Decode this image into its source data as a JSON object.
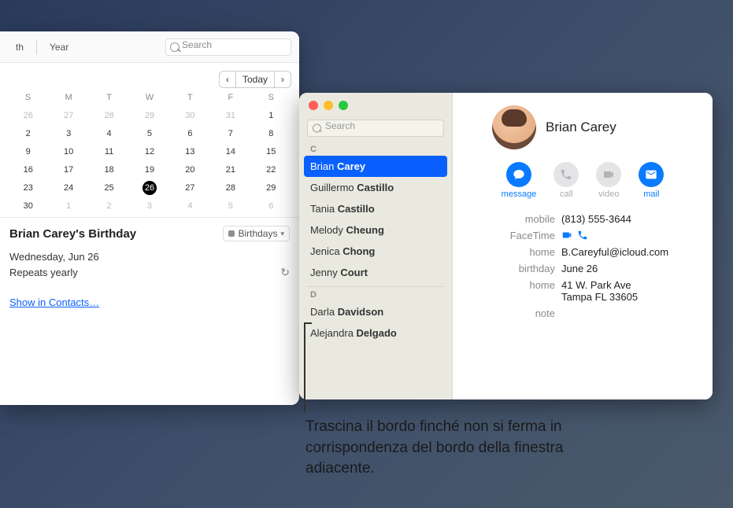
{
  "calendar": {
    "toolbar": {
      "view_th_label": "th",
      "view_year_label": "Year",
      "search_placeholder": "Search",
      "today_label": "Today"
    },
    "dow": [
      "S",
      "M",
      "T",
      "W",
      "T",
      "F",
      "S"
    ],
    "weeks": [
      [
        26,
        27,
        28,
        29,
        30,
        31,
        1
      ],
      [
        2,
        3,
        4,
        5,
        6,
        7,
        8
      ],
      [
        9,
        10,
        11,
        12,
        13,
        14,
        15
      ],
      [
        16,
        17,
        18,
        19,
        20,
        21,
        22
      ],
      [
        23,
        24,
        25,
        26,
        27,
        28,
        29
      ],
      [
        30,
        1,
        2,
        3,
        4,
        5,
        6
      ]
    ],
    "red_day": 10,
    "selected_day": 26,
    "event": {
      "title": "Brian Carey's Birthday",
      "calendar_name": "Birthdays",
      "date_line": "Wednesday, Jun 26",
      "repeat_line": "Repeats yearly",
      "show_link": "Show in Contacts…"
    }
  },
  "contacts": {
    "search_placeholder": "Search",
    "sections": [
      {
        "letter": "C",
        "items": [
          {
            "first": "Brian",
            "last": "Carey",
            "selected": true
          },
          {
            "first": "Guillermo",
            "last": "Castillo"
          },
          {
            "first": "Tania",
            "last": "Castillo"
          },
          {
            "first": "Melody",
            "last": "Cheung"
          },
          {
            "first": "Jenica",
            "last": "Chong"
          },
          {
            "first": "Jenny",
            "last": "Court"
          }
        ]
      },
      {
        "letter": "D",
        "items": [
          {
            "first": "Darla",
            "last": "Davidson"
          },
          {
            "first": "Alejandra",
            "last": "Delgado"
          }
        ]
      }
    ],
    "detail": {
      "name": "Brian Carey",
      "actions": {
        "message": "message",
        "call": "call",
        "video": "video",
        "mail": "mail"
      },
      "fields": {
        "mobile_label": "mobile",
        "mobile_value": "(813) 555-3644",
        "facetime_label": "FaceTime",
        "home_email_label": "home",
        "home_email_value": "B.Careyful@icloud.com",
        "birthday_label": "birthday",
        "birthday_value": "June 26",
        "home_addr_label": "home",
        "home_addr_value_l1": "41 W. Park Ave",
        "home_addr_value_l2": "Tampa FL 33605",
        "note_label": "note"
      }
    }
  },
  "callout": "Trascina il bordo finché non si ferma in corrispondenza del bordo della finestra adiacente."
}
